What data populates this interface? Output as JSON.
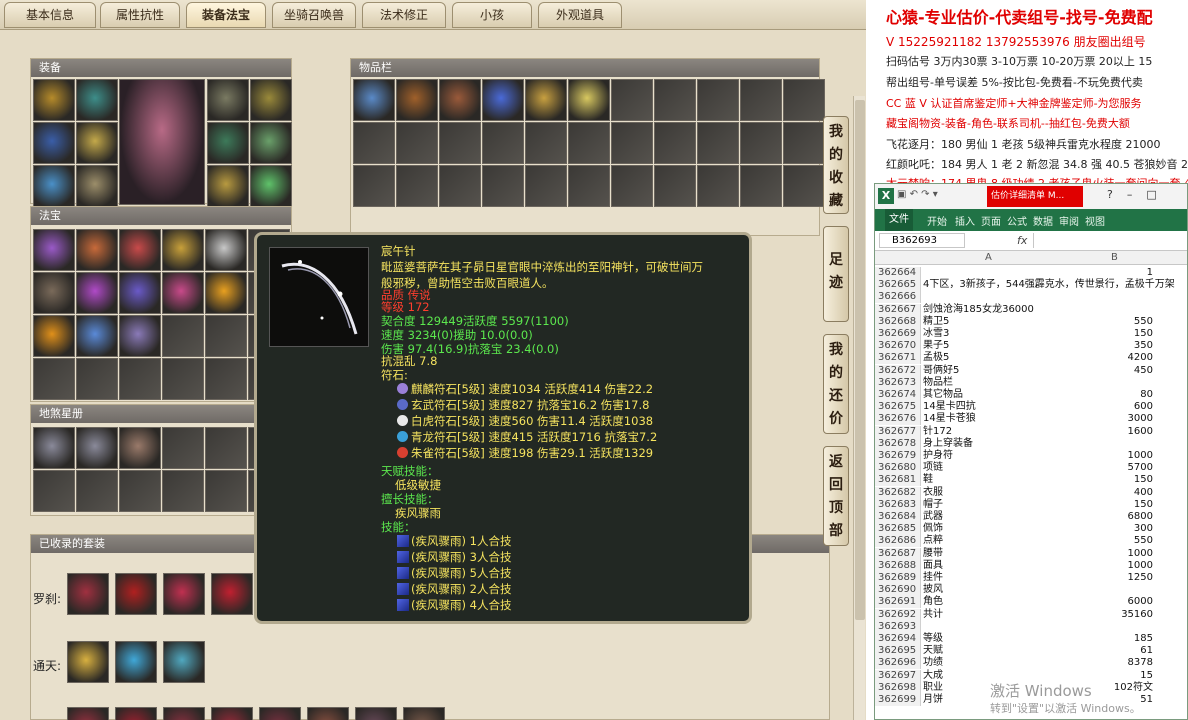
{
  "tabs": [
    "基本信息",
    "属性抗性",
    "装备法宝",
    "坐骑召唤兽",
    "法术修正",
    "小孩",
    "外观道具"
  ],
  "panels": {
    "equip": "装备",
    "treasure": "法宝",
    "inventory": "物品栏",
    "tianditu": "地煞星册",
    "suits": "已收录的套装"
  },
  "side_buttons": [
    "我的收藏",
    "足迹",
    "我的还价",
    "返回顶部"
  ],
  "suits": [
    {
      "label": "罗刹:"
    },
    {
      "label": "通天:"
    }
  ],
  "tooltip": {
    "name": "宸午针",
    "desc1": "毗蓝婆菩萨在其子昴日星官眼中淬炼出的至阳神针，可破世间万",
    "desc2": "般邪秽，曾助悟空击败百眼道人。",
    "quality": "品质 传说",
    "level": "等级 172",
    "stats": [
      "契合度    129449活跃度  5597(1100)",
      "速度     3234(0)援助    10.0(0.0)",
      "伤害    97.4(16.9)抗落宝   23.4(0.0)"
    ],
    "resist": "抗混乱 7.8",
    "rune_title": "符石:",
    "runes": [
      "麒麟符石[5级] 速度1034 活跃度414 伤害22.2",
      "玄武符石[5级] 速度827 抗落宝16.2 伤害17.8",
      "白虎符石[5级] 速度560 伤害11.4 活跃度1038",
      "青龙符石[5级] 速度415 活跃度1716 抗落宝7.2",
      "朱雀符石[5级] 速度198 伤害29.1 活跃度1329"
    ],
    "talent_title": "天赋技能：",
    "talent": "低级敏捷",
    "special_title": "擅长技能：",
    "special": "疾风骤雨",
    "skills_title": "技能：",
    "skills": [
      "(疾风骤雨) 1人合技",
      "(疾风骤雨) 3人合技",
      "(疾风骤雨) 5人合技",
      "(疾风骤雨) 2人合技",
      "(疾风骤雨) 4人合技"
    ]
  },
  "chat": {
    "line1": "心猿-专业估价-代卖组号-找号-免费配",
    "line2": "V 15225921182  13792553976 朋友圈出组号",
    "line3": "扫码估号 3万内30票 3-10万票 10-20万票 20以上 15",
    "line4": "帮出组号-单号误差 5%-按比包-免费看-不玩免费代卖",
    "line5": "CC 蓝 V 认证首席鉴定师+大神金牌鉴定师-为您服务",
    "line6": "藏宝阁物资-装备-角色-联系司机--抽红包-免费大额",
    "line7": "飞花逐月：180 男仙 1 老孩 5级神兵雷克水程度 21000",
    "line8": "红颜叱吒：184 男人 1 老 2 新忽混 34.8 强 40.5 苍狼妙音 255",
    "line9": "太元焚响：174 男鬼 8 级功绩 2 老孩子鬼火装一套间向一套 4"
  },
  "excel": {
    "title_badge": "估价详细清单 M...",
    "tabs": [
      "文件",
      "开始",
      "插入",
      "页面",
      "公式",
      "数据",
      "审阅",
      "视图"
    ],
    "name_box": "B362693",
    "fx": "fx",
    "col_a": "A",
    "col_b": "B",
    "rows": [
      {
        "n": "362664",
        "a": "",
        "b": "1"
      },
      {
        "n": "362665",
        "a": "4下区，3新孩子，544强霹克水，传世景行，孟极千万架",
        "b": ""
      },
      {
        "n": "362666",
        "a": "",
        "b": ""
      },
      {
        "n": "362667",
        "a": "剑蚀沧海185女龙36000",
        "b": ""
      },
      {
        "n": "362668",
        "a": "精卫5",
        "b": "550"
      },
      {
        "n": "362669",
        "a": "冰雪3",
        "b": "150"
      },
      {
        "n": "362670",
        "a": "果子5",
        "b": "350"
      },
      {
        "n": "362671",
        "a": "孟极5",
        "b": "4200"
      },
      {
        "n": "362672",
        "a": "哥俩好5",
        "b": "450"
      },
      {
        "n": "362673",
        "a": "物品栏",
        "b": ""
      },
      {
        "n": "362674",
        "a": "其它物品",
        "b": "80"
      },
      {
        "n": "362675",
        "a": "14星卡四抗",
        "b": "600"
      },
      {
        "n": "362676",
        "a": "14星卡苍狼",
        "b": "3000"
      },
      {
        "n": "362677",
        "a": "针172",
        "b": "1600"
      },
      {
        "n": "362678",
        "a": "身上穿装备",
        "b": ""
      },
      {
        "n": "362679",
        "a": "护身符",
        "b": "1000"
      },
      {
        "n": "362680",
        "a": "项链",
        "b": "5700"
      },
      {
        "n": "362681",
        "a": "鞋",
        "b": "150"
      },
      {
        "n": "362682",
        "a": "衣服",
        "b": "400"
      },
      {
        "n": "362683",
        "a": "帽子",
        "b": "150"
      },
      {
        "n": "362684",
        "a": "武器",
        "b": "6800"
      },
      {
        "n": "362685",
        "a": "佩饰",
        "b": "300"
      },
      {
        "n": "362686",
        "a": "点粹",
        "b": "550"
      },
      {
        "n": "362687",
        "a": "腰带",
        "b": "1000"
      },
      {
        "n": "362688",
        "a": "面具",
        "b": "1000"
      },
      {
        "n": "362689",
        "a": "挂件",
        "b": "1250"
      },
      {
        "n": "362690",
        "a": "披风",
        "b": ""
      },
      {
        "n": "362691",
        "a": "角色",
        "b": "6000"
      },
      {
        "n": "362692",
        "a": "共计",
        "b": "35160"
      },
      {
        "n": "362693",
        "a": "",
        "b": ""
      },
      {
        "n": "362694",
        "a": "等级",
        "b": "185"
      },
      {
        "n": "362695",
        "a": "天赋",
        "b": "61"
      },
      {
        "n": "362696",
        "a": "功绩",
        "b": "8378"
      },
      {
        "n": "362697",
        "a": "大成",
        "b": "15"
      },
      {
        "n": "362698",
        "a": "职业",
        "b": "102符文"
      },
      {
        "n": "362699",
        "a": "月饼",
        "b": "51"
      }
    ]
  },
  "watermark": {
    "line1": "激活 Windows",
    "line2": "转到\"设置\"以激活 Windows。"
  }
}
